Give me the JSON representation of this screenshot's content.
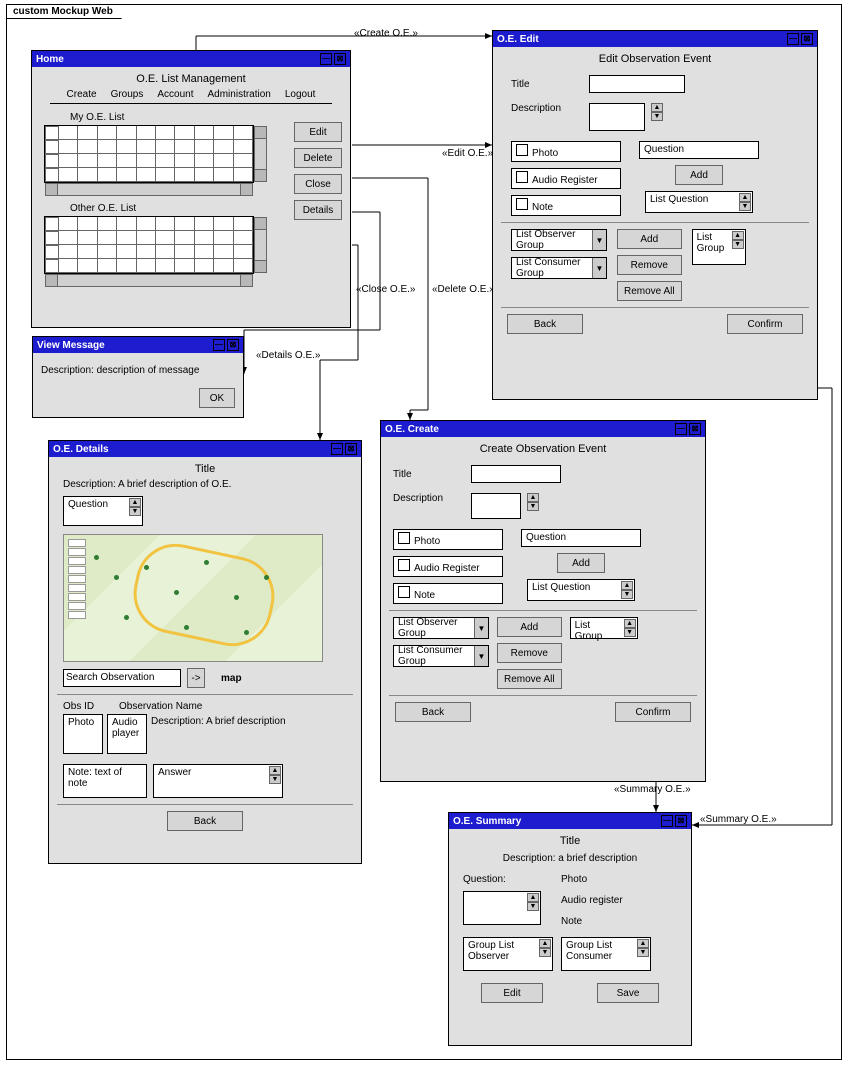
{
  "frame": {
    "title": "custom Mockup Web"
  },
  "home": {
    "title": "Home",
    "header": "O.E. List Management",
    "nav": [
      "Create",
      "Groups",
      "Account",
      "Administration",
      "Logout"
    ],
    "my_list_label": "My O.E. List",
    "other_list_label": "Other O.E. List",
    "buttons": {
      "edit": "Edit",
      "delete": "Delete",
      "close": "Close",
      "details": "Details"
    }
  },
  "view_message": {
    "title": "View Message",
    "description": "Description: description of message",
    "ok": "OK"
  },
  "oe_details": {
    "title": "O.E. Details",
    "h_title": "Title",
    "description": "Description: A brief description of O.E.",
    "question": "Question",
    "map_caption": "map",
    "search_placeholder": "Search Observation",
    "obs_id": "Obs ID",
    "obs_name": "Observation Name",
    "photo": "Photo",
    "audio_player": "Audio player",
    "obs_desc": "Description: A brief description",
    "note": "Note: text of note",
    "answer": "Answer",
    "back": "Back"
  },
  "oe_edit": {
    "title": "O.E. Edit",
    "header": "Edit Observation Event",
    "title_label": "Title",
    "desc_label": "Description",
    "photo": "Photo",
    "audio": "Audio Register",
    "note": "Note",
    "question": "Question",
    "add": "Add",
    "list_question": "List Question",
    "list_observer": "List Observer Group",
    "list_consumer": "List Consumer Group",
    "remove": "Remove",
    "remove_all": "Remove All",
    "list_group": "List Group",
    "back": "Back",
    "confirm": "Confirm"
  },
  "oe_create": {
    "title": "O.E. Create",
    "header": "Create Observation Event",
    "title_label": "Title",
    "desc_label": "Description",
    "photo": "Photo",
    "audio": "Audio Register",
    "note": "Note",
    "question": "Question",
    "add": "Add",
    "list_question": "List Question",
    "list_observer": "List Observer Group",
    "list_consumer": "List Consumer Group",
    "remove": "Remove",
    "remove_all": "Remove All",
    "list_group": "List Group",
    "back": "Back",
    "confirm": "Confirm"
  },
  "oe_summary": {
    "title": "O.E. Summary",
    "h_title": "Title",
    "description": "Description: a brief description",
    "question": "Question:",
    "photo": "Photo",
    "audio": "Audio register",
    "note": "Note",
    "group_observer": "Group List Observer",
    "group_consumer": "Group List Consumer",
    "edit": "Edit",
    "save": "Save"
  },
  "transitions": {
    "create": "«Create O.E.»",
    "edit": "«Edit O.E.»",
    "close": "«Close O.E.»",
    "delete": "«Delete O.E.»",
    "details": "«Details O.E.»",
    "summary": "«Summary O.E.»"
  }
}
